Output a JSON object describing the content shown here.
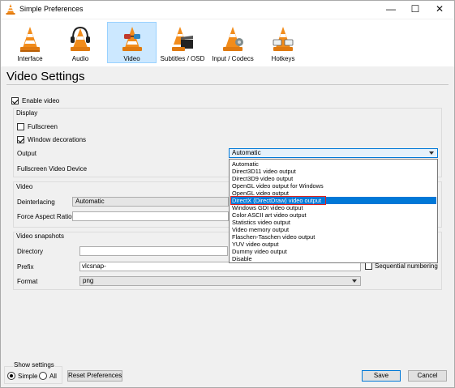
{
  "window": {
    "title": "Simple Preferences",
    "minimize_glyph": "—",
    "maximize_glyph": "☐",
    "close_glyph": "✕"
  },
  "categories": [
    {
      "label": "Interface",
      "icon": "vlc-cone-icon"
    },
    {
      "label": "Audio",
      "icon": "headphones-cone-icon"
    },
    {
      "label": "Video",
      "icon": "glasses-cone-icon",
      "selected": true
    },
    {
      "label": "Subtitles / OSD",
      "icon": "clapperboard-cone-icon"
    },
    {
      "label": "Input / Codecs",
      "icon": "network-cone-icon"
    },
    {
      "label": "Hotkeys",
      "icon": "hotkeys-cone-icon"
    }
  ],
  "page": {
    "heading": "Video Settings",
    "enable_video": {
      "label": "Enable video",
      "checked": true
    }
  },
  "display": {
    "title": "Display",
    "fullscreen": {
      "label": "Fullscreen",
      "checked": false
    },
    "window_decorations": {
      "label": "Window decorations",
      "checked": true
    },
    "output_label": "Output",
    "output_value": "Automatic",
    "fullscreen_device_label": "Fullscreen Video Device"
  },
  "output_dropdown": {
    "options": [
      "Automatic",
      "Direct3D11 video output",
      "Direct3D9 video output",
      "OpenGL video output for Windows",
      "OpenGL video output",
      "DirectX (DirectDraw) video output",
      "Windows GDI video output",
      "Color ASCII art video output",
      "Statistics video output",
      "Video memory output",
      "Flaschen-Taschen video output",
      "YUV video output",
      "Dummy video output",
      "Disable"
    ],
    "highlighted_index": 5
  },
  "video": {
    "title": "Video",
    "deinterlacing_label": "Deinterlacing",
    "deinterlacing_value": "Automatic",
    "aspect_label": "Force Aspect Ratio",
    "aspect_value": ""
  },
  "snapshots": {
    "title": "Video snapshots",
    "directory_label": "Directory",
    "directory_value": "",
    "browse_label": "...",
    "prefix_label": "Prefix",
    "prefix_value": "vlcsnap-",
    "sequential_label": "Sequential numbering",
    "sequential_checked": false,
    "format_label": "Format",
    "format_value": "png"
  },
  "footer": {
    "show_settings_title": "Show settings",
    "simple_label": "Simple",
    "simple_checked": true,
    "all_label": "All",
    "all_checked": false,
    "reset_label": "Reset Preferences",
    "save_label": "Save",
    "cancel_label": "Cancel"
  },
  "colors": {
    "selection_blue": "#0078d7",
    "selected_category_bg": "#cce8ff",
    "highlight_outline": "#e0201b",
    "cone_orange": "#f28c1b"
  }
}
